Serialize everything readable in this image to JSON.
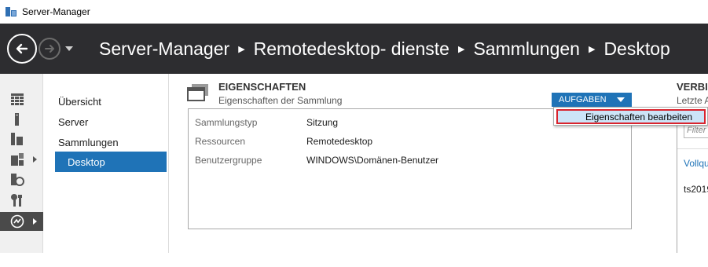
{
  "window": {
    "title": "Server-Manager",
    "app_icon": "server-manager-icon"
  },
  "header": {
    "back_icon": "back-arrow-icon",
    "forward_icon": "forward-arrow-icon",
    "breadcrumb": [
      "Server-Manager",
      "Remotedesktop- dienste",
      "Sammlungen",
      "Desktop"
    ],
    "separator_icon": "triangle-right-icon",
    "background": "#2d2d30"
  },
  "left_rail": {
    "items": [
      {
        "icon": "dashboard-icon"
      },
      {
        "icon": "local-server-icon"
      },
      {
        "icon": "all-servers-icon"
      },
      {
        "icon": "file-storage-icon",
        "expandable": true
      },
      {
        "icon": "iis-icon"
      },
      {
        "icon": "tools-icon"
      },
      {
        "icon": "remote-desktop-services-icon",
        "expandable": true,
        "active": true
      }
    ]
  },
  "subnav": {
    "items": [
      {
        "label": "Übersicht"
      },
      {
        "label": "Server"
      },
      {
        "label": "Sammlungen"
      },
      {
        "label": "Desktop",
        "selected": true
      }
    ],
    "selected_color": "#1f73b7"
  },
  "properties": {
    "title": "EIGENSCHAFTEN",
    "subtitle": "Eigenschaften der Sammlung",
    "tasks_label": "AUFGABEN",
    "rows": [
      {
        "key": "Sammlungstyp",
        "value": "Sitzung"
      },
      {
        "key": "Ressourcen",
        "value": "Remotedesktop"
      },
      {
        "key": "Benutzergruppe",
        "value": "WINDOWS\\Domänen-Benutzer"
      }
    ]
  },
  "tasks_menu": {
    "items": [
      {
        "label": "Eigenschaften bearbeiten",
        "highlighted": true
      }
    ],
    "highlight_border": "#d9232d"
  },
  "right_panel": {
    "title": "VERBI",
    "subtitle": "Letzte A",
    "filter_placeholder": "Filter",
    "link": "Vollqu",
    "value": "ts2019"
  },
  "colors": {
    "accent": "#1f73b7",
    "header_bg": "#2d2d30"
  }
}
